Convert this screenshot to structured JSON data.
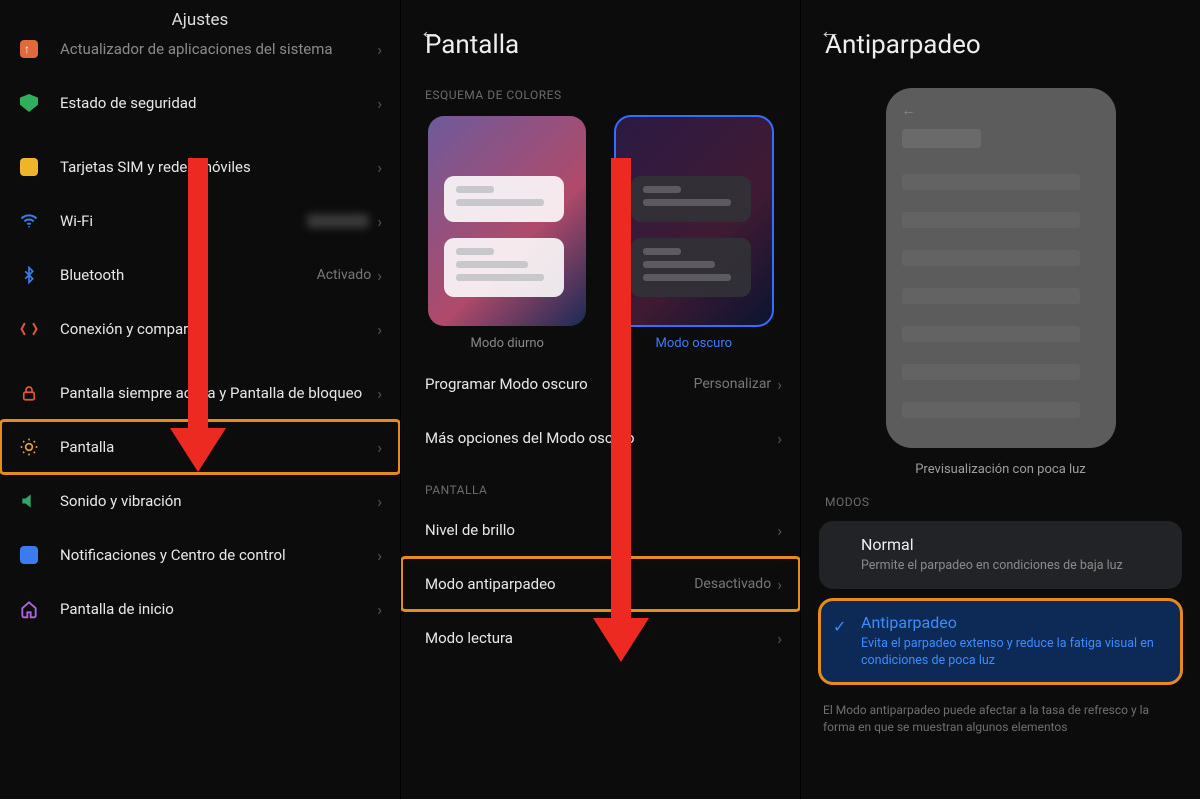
{
  "pane1": {
    "title": "Ajustes",
    "items": {
      "update": {
        "label": "Actualizador de aplicaciones del sistema"
      },
      "security": {
        "label": "Estado de seguridad"
      },
      "sim": {
        "label": "Tarjetas SIM y redes móviles"
      },
      "wifi": {
        "label": "Wi-Fi"
      },
      "bt": {
        "label": "Bluetooth",
        "value": "Activado"
      },
      "share": {
        "label": "Conexión y compartir"
      },
      "lock": {
        "label": "Pantalla siempre activa y Pantalla de bloqueo"
      },
      "display": {
        "label": "Pantalla"
      },
      "sound": {
        "label": "Sonido y vibración"
      },
      "notif": {
        "label": "Notificaciones y Centro de control"
      },
      "home": {
        "label": "Pantalla de inicio"
      }
    }
  },
  "pane2": {
    "title": "Pantalla",
    "section_scheme": "ESQUEMA DE COLORES",
    "scheme_light": "Modo diurno",
    "scheme_dark": "Modo oscuro",
    "rows": {
      "program": {
        "label": "Programar Modo oscuro",
        "value": "Personalizar"
      },
      "more_dark": {
        "label": "Más opciones del Modo oscuro"
      }
    },
    "section_display": "PANTALLA",
    "rows2": {
      "bright": {
        "label": "Nivel de brillo"
      },
      "anti": {
        "label": "Modo antiparpadeo",
        "value": "Desactivado"
      },
      "read": {
        "label": "Modo lectura"
      }
    }
  },
  "pane3": {
    "title": "Antiparpadeo",
    "preview_caption": "Previsualización con poca luz",
    "section_modes": "MODOS",
    "modes": {
      "normal": {
        "title": "Normal",
        "desc": "Permite el parpadeo en condiciones de baja luz"
      },
      "anti": {
        "title": "Antiparpadeo",
        "desc": "Evita el parpadeo extenso y reduce la fatiga visual en condiciones de poca luz"
      }
    },
    "footnote": "El Modo antiparpadeo puede afectar a la tasa de refresco y la forma en que se muestran algunos elementos"
  }
}
